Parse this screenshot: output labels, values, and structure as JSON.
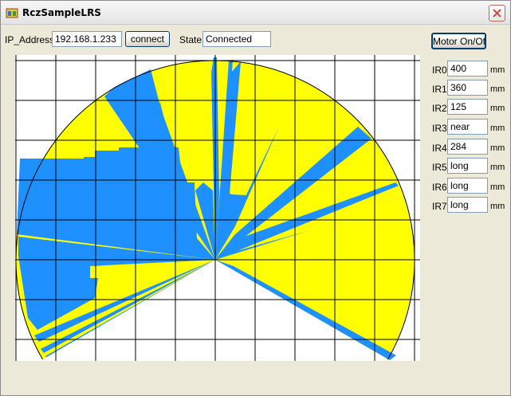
{
  "window": {
    "title": "RczSampleLRS"
  },
  "connection": {
    "ip_label": "IP_Address",
    "ip_value": "192.168.1.233",
    "connect_label": "connect",
    "state_label": "State",
    "state_value": "Connected"
  },
  "motor_button_label": "Motor On/Off",
  "ir_sensors": [
    {
      "label": "IR0",
      "value": "400",
      "unit": "mm"
    },
    {
      "label": "IR1",
      "value": "360",
      "unit": "mm"
    },
    {
      "label": "IR2",
      "value": "125",
      "unit": "mm"
    },
    {
      "label": "IR3",
      "value": "near",
      "unit": "mm"
    },
    {
      "label": "IR4",
      "value": "284",
      "unit": "mm"
    },
    {
      "label": "IR5",
      "value": "long",
      "unit": "mm"
    },
    {
      "label": "IR6",
      "value": "long",
      "unit": "mm"
    },
    {
      "label": "IR7",
      "value": "long",
      "unit": "mm"
    }
  ],
  "colors": {
    "scan_area": "#ffff00",
    "obstacle": "#1e90ff",
    "grid": "#000000"
  },
  "icons": {
    "app": "app-icon",
    "close": "close-icon"
  }
}
